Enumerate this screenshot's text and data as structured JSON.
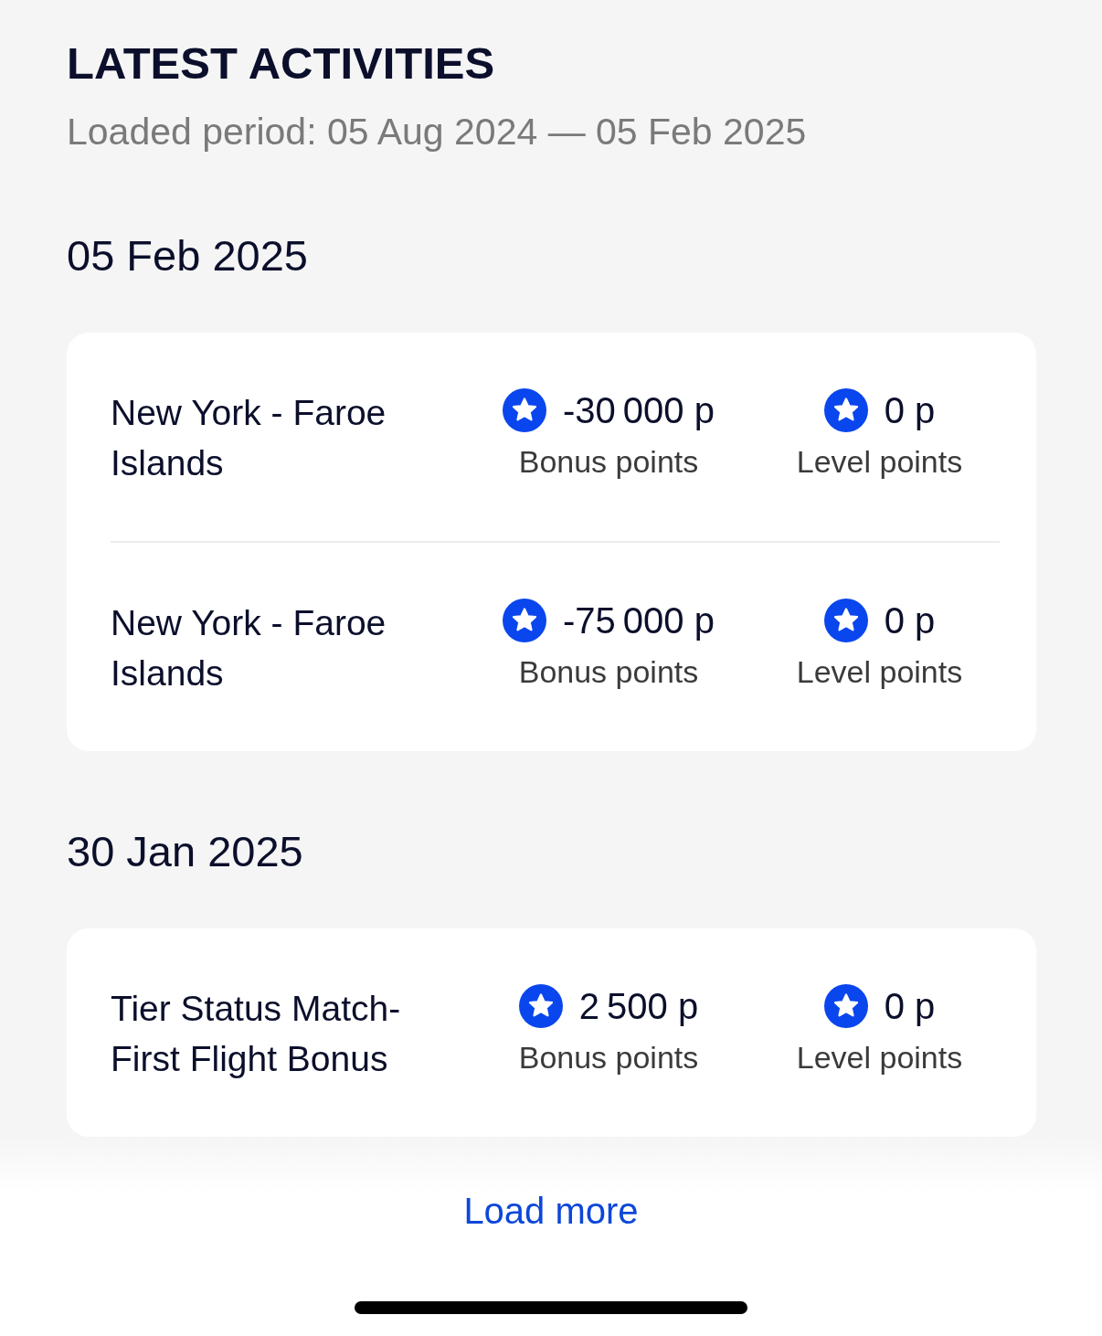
{
  "header": {
    "title": "LATEST ACTIVITIES",
    "period": "Loaded period: 05 Aug 2024 — 05 Feb 2025"
  },
  "groups": [
    {
      "date": "05 Feb 2025",
      "activities": [
        {
          "name": "New York - Faroe Islands",
          "points": [
            {
              "value": "-30 000 p",
              "label": "Bonus points"
            },
            {
              "value": "0 p",
              "label": "Level points"
            }
          ]
        },
        {
          "name": "New York - Faroe Islands",
          "points": [
            {
              "value": "-75 000 p",
              "label": "Bonus points"
            },
            {
              "value": "0 p",
              "label": "Level points"
            }
          ]
        }
      ]
    },
    {
      "date": "30 Jan 2025",
      "activities": [
        {
          "name": "Tier Status Match-First Flight Bonus",
          "points": [
            {
              "value": "2 500 p",
              "label": "Bonus points"
            },
            {
              "value": "0 p",
              "label": "Level points"
            }
          ]
        }
      ]
    }
  ],
  "load_more": "Load more"
}
